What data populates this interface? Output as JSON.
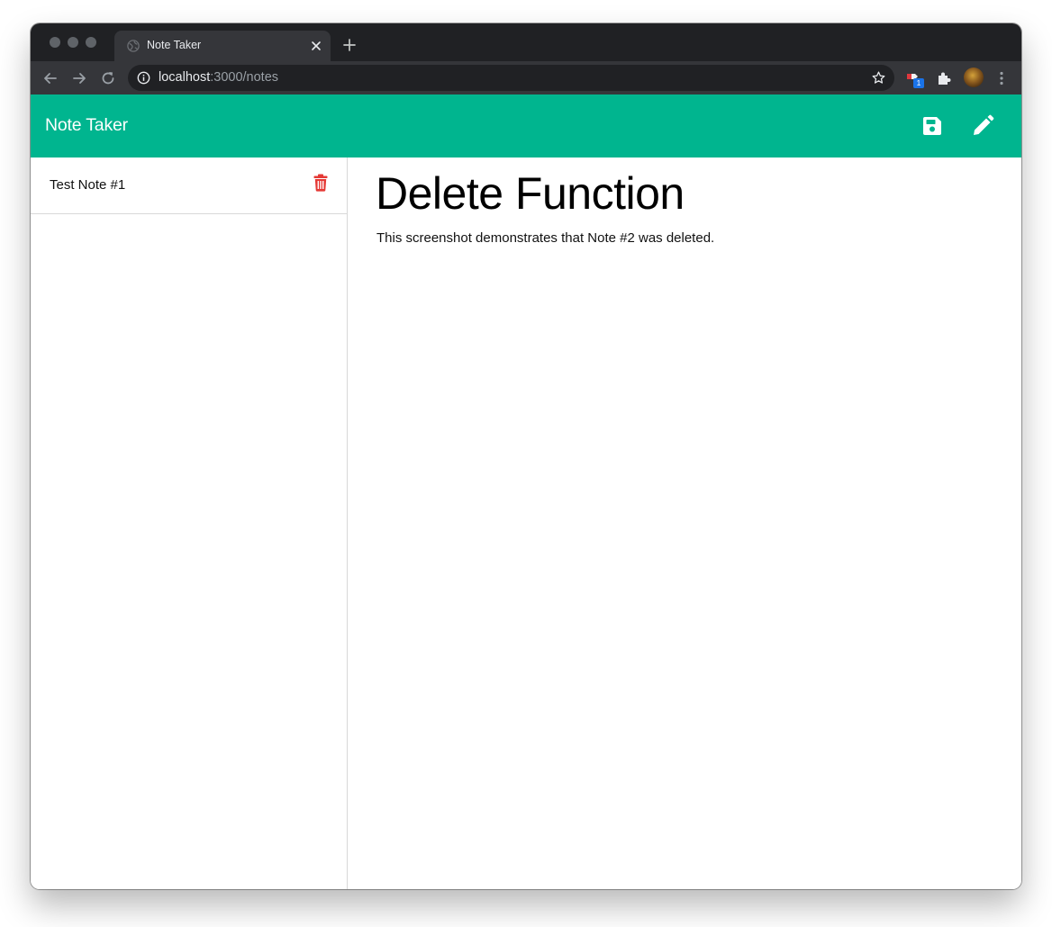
{
  "browser": {
    "tab": {
      "title": "Note Taker"
    },
    "address_bar": {
      "host": "localhost",
      "path": ":3000/notes"
    },
    "extensions": [
      {
        "icon": "extension-badge-icon",
        "badge": "1"
      },
      {
        "icon": "puzzle-icon"
      }
    ],
    "colors": {
      "chrome_dark": "#202124",
      "chrome_toolbar": "#35363a"
    }
  },
  "app": {
    "title": "Note Taker",
    "header_icons": [
      "save-icon",
      "pencil-icon"
    ],
    "colors": {
      "header": "#00b58f",
      "delete": "#e53935"
    }
  },
  "sidebar": {
    "notes": [
      {
        "title": "Test Note #1"
      }
    ]
  },
  "active_note": {
    "title": "Delete Function",
    "text": "This screenshot demonstrates that Note #2 was deleted."
  }
}
